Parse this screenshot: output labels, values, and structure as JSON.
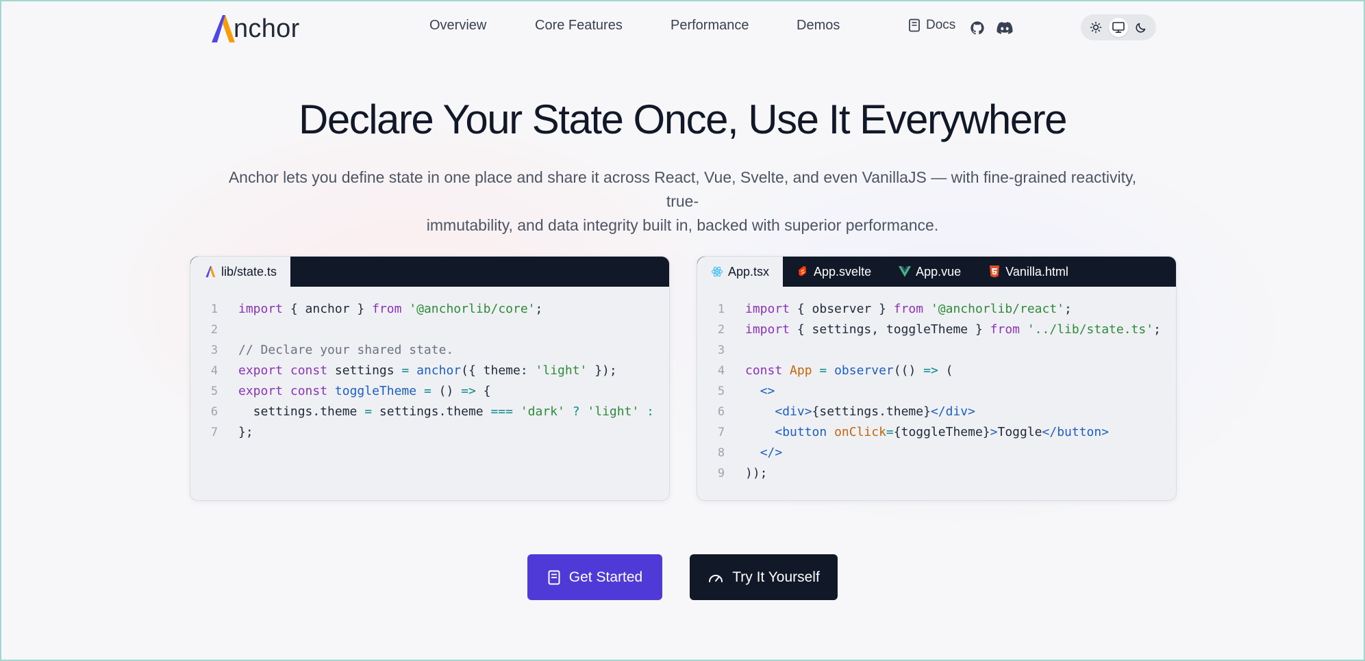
{
  "brand": {
    "name": "nchor"
  },
  "nav": {
    "items": [
      "Overview",
      "Core Features",
      "Performance",
      "Demos"
    ],
    "docs_label": "Docs"
  },
  "icons": {
    "docs": "book-icon",
    "github": "github-icon",
    "discord": "discord-icon",
    "theme_light": "sun-icon",
    "theme_system": "monitor-icon",
    "theme_dark": "moon-icon",
    "get_started": "book-icon",
    "try": "gauge-icon"
  },
  "theme_switch": {
    "selected": "system"
  },
  "hero": {
    "title": "Declare Your State Once, Use It Everywhere",
    "subtitle_line1": "Anchor lets you define state in one place and share it across React, Vue, Svelte, and even VanillaJS — with fine-grained reactivity, true-",
    "subtitle_line2": "immutability, and data integrity built in, backed with superior performance."
  },
  "left_panel": {
    "tabs": [
      {
        "label": "lib/state.ts",
        "active": true
      }
    ],
    "lines": [
      [
        [
          "t-kw",
          "import"
        ],
        [
          "t-pl",
          " { anchor } "
        ],
        [
          "t-kw",
          "from"
        ],
        [
          "t-pl",
          " "
        ],
        [
          "t-str",
          "'@anchorlib/core'"
        ],
        [
          "t-pl",
          ";"
        ]
      ],
      [],
      [
        [
          "t-cm",
          "// Declare your shared state."
        ]
      ],
      [
        [
          "t-kw",
          "export const"
        ],
        [
          "t-pl",
          " settings "
        ],
        [
          "t-op",
          "="
        ],
        [
          "t-pl",
          " "
        ],
        [
          "t-fn",
          "anchor"
        ],
        [
          "t-pl",
          "({ theme: "
        ],
        [
          "t-str",
          "'light'"
        ],
        [
          "t-pl",
          " });"
        ]
      ],
      [
        [
          "t-kw",
          "export const"
        ],
        [
          "t-pl",
          " "
        ],
        [
          "t-fn",
          "toggleTheme"
        ],
        [
          "t-pl",
          " "
        ],
        [
          "t-op",
          "="
        ],
        [
          "t-pl",
          " () "
        ],
        [
          "t-op",
          "=>"
        ],
        [
          "t-pl",
          " {"
        ]
      ],
      [
        [
          "t-pl",
          "  settings.theme "
        ],
        [
          "t-op",
          "="
        ],
        [
          "t-pl",
          " settings.theme "
        ],
        [
          "t-op",
          "==="
        ],
        [
          "t-pl",
          " "
        ],
        [
          "t-str",
          "'dark'"
        ],
        [
          "t-pl",
          " "
        ],
        [
          "t-op",
          "?"
        ],
        [
          "t-pl",
          " "
        ],
        [
          "t-str",
          "'light'"
        ],
        [
          "t-pl",
          " "
        ],
        [
          "t-op",
          ":"
        ]
      ],
      [
        [
          "t-pl",
          "};"
        ]
      ]
    ]
  },
  "right_panel": {
    "tabs": [
      {
        "label": "App.tsx",
        "active": true,
        "icon": "react-icon"
      },
      {
        "label": "App.svelte",
        "active": false,
        "icon": "svelte-icon"
      },
      {
        "label": "App.vue",
        "active": false,
        "icon": "vue-icon"
      },
      {
        "label": "Vanilla.html",
        "active": false,
        "icon": "html5-icon"
      }
    ],
    "lines": [
      [
        [
          "t-kw",
          "import"
        ],
        [
          "t-pl",
          " { observer } "
        ],
        [
          "t-kw",
          "from"
        ],
        [
          "t-pl",
          " "
        ],
        [
          "t-str",
          "'@anchorlib/react'"
        ],
        [
          "t-pl",
          ";"
        ]
      ],
      [
        [
          "t-kw",
          "import"
        ],
        [
          "t-pl",
          " { settings, toggleTheme } "
        ],
        [
          "t-kw",
          "from"
        ],
        [
          "t-pl",
          " "
        ],
        [
          "t-str",
          "'../lib/state.ts'"
        ],
        [
          "t-pl",
          ";"
        ]
      ],
      [],
      [
        [
          "t-kw",
          "const"
        ],
        [
          "t-pl",
          " "
        ],
        [
          "t-comp",
          "App"
        ],
        [
          "t-pl",
          " "
        ],
        [
          "t-op",
          "="
        ],
        [
          "t-pl",
          " "
        ],
        [
          "t-fn",
          "observer"
        ],
        [
          "t-pl",
          "(() "
        ],
        [
          "t-op",
          "=>"
        ],
        [
          "t-pl",
          " ("
        ]
      ],
      [
        [
          "t-pl",
          "  "
        ],
        [
          "t-tag",
          "<>"
        ]
      ],
      [
        [
          "t-pl",
          "    "
        ],
        [
          "t-tag",
          "<div>"
        ],
        [
          "t-pl",
          "{settings.theme}"
        ],
        [
          "t-tag",
          "</div>"
        ]
      ],
      [
        [
          "t-pl",
          "    "
        ],
        [
          "t-tag",
          "<button"
        ],
        [
          "t-pl",
          " "
        ],
        [
          "t-attr",
          "onClick"
        ],
        [
          "t-op",
          "="
        ],
        [
          "t-pl",
          "{toggleTheme}"
        ],
        [
          "t-tag",
          ">"
        ],
        [
          "t-pl",
          "Toggle"
        ],
        [
          "t-tag",
          "</button>"
        ]
      ],
      [
        [
          "t-pl",
          "  "
        ],
        [
          "t-tag",
          "</>"
        ]
      ],
      [
        [
          "t-pl",
          "));"
        ]
      ]
    ]
  },
  "buttons": {
    "get_started": "Get Started",
    "try_it": "Try It Yourself"
  },
  "colors": {
    "primary": "#4f3ad8",
    "dark": "#111827",
    "logo_a_left": "#4f46e5",
    "logo_a_right": "#f59e0b"
  }
}
